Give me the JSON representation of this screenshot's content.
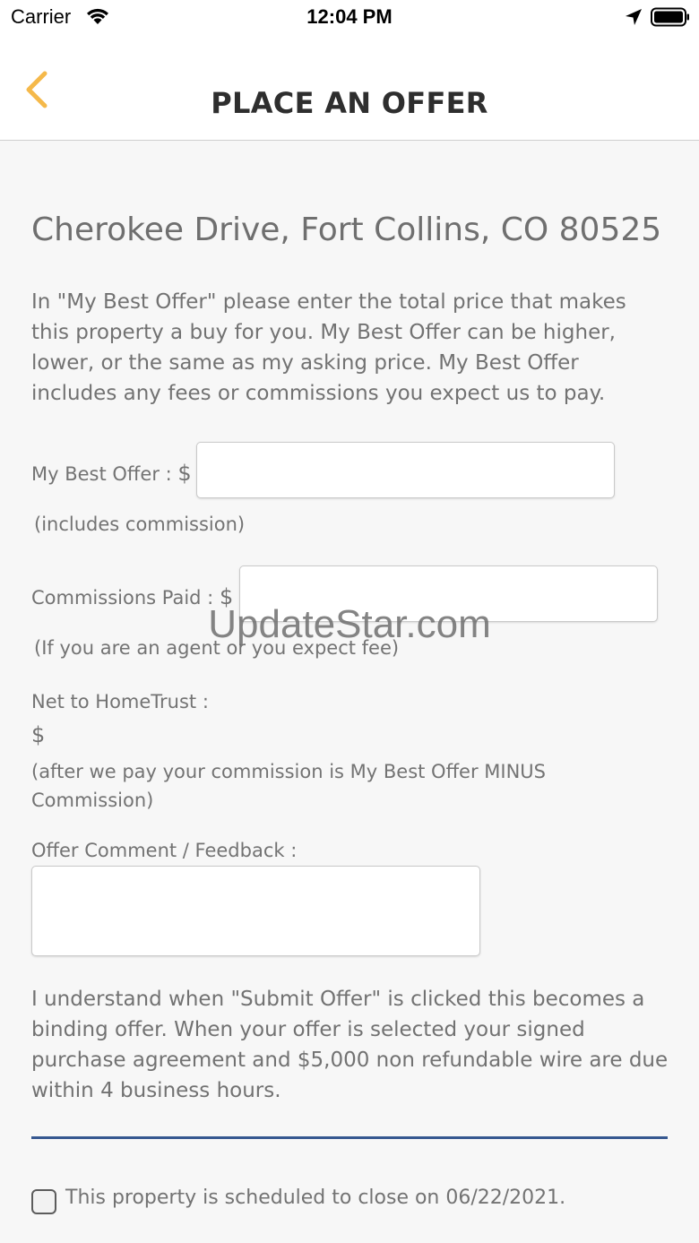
{
  "status_bar": {
    "carrier": "Carrier",
    "time": "12:04 PM",
    "icons": [
      "wifi-icon",
      "location-arrow-icon",
      "battery-icon"
    ]
  },
  "nav": {
    "title": "PLACE AN OFFER",
    "back_icon": "chevron-left-icon",
    "accent_color": "#f5b94a"
  },
  "property": {
    "address": "Cherokee Drive, Fort Collins, CO 80525"
  },
  "intro_text": "In \"My Best Offer\" please enter the total price that makes this property a buy for you. My Best Offer can be higher, lower, or the same as my asking price. My Best Offer includes any fees or commissions you expect us to pay.",
  "fields": {
    "best_offer": {
      "label": "My Best Offer : ",
      "currency": "$",
      "value": "",
      "hint": "(includes commission)"
    },
    "commissions": {
      "label": "Commissions Paid : ",
      "currency": "$",
      "value": "",
      "hint": "(If you are an agent or you expect fee)"
    },
    "net": {
      "label": "Net to HomeTrust :",
      "currency": "$",
      "hint": "(after we pay your commission is My Best Offer MINUS Commission)"
    },
    "comment": {
      "label": "Offer Comment / Feedback :",
      "value": ""
    }
  },
  "disclaimer": "I understand when \"Submit Offer\" is clicked this becomes a binding offer. When your offer is selected your signed purchase agreement and $5,000 non refundable wire are due within 4 business hours.",
  "divider_color": "#365890",
  "close_checkbox": {
    "label": "This property is scheduled to close on 06/22/2021.",
    "checked": false
  },
  "watermark": "UpdateStar.com"
}
